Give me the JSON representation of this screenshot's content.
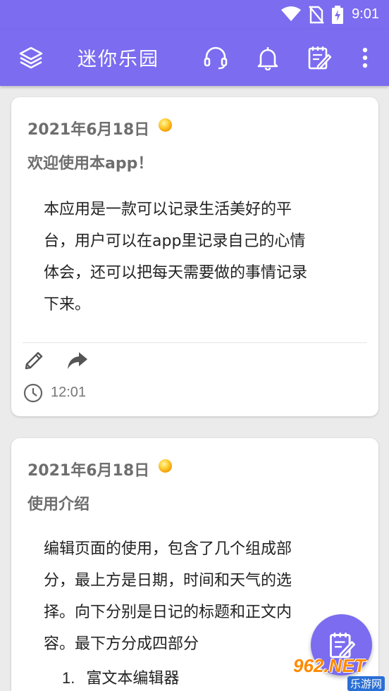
{
  "status_bar": {
    "time": "9:01",
    "icons": [
      "wifi-icon",
      "no-sim-icon",
      "battery-charging-icon"
    ]
  },
  "app_bar": {
    "title": "迷你乐园",
    "icons": [
      "layers-icon",
      "headset-icon",
      "bell-icon",
      "edit-note-icon",
      "more-vert-icon"
    ]
  },
  "entries": [
    {
      "date": "2021年6月18日",
      "weather_icon": "sun-icon",
      "title": "欢迎使用本app！",
      "body_lines": [
        "本应用是一款可以记录生活美好的平",
        "台，用户可以在app里记录自己的心情",
        "体会，还可以把每天需要做的事情记录",
        "下来。"
      ],
      "actions": [
        "pencil-icon",
        "share-icon"
      ],
      "time": "12:01"
    },
    {
      "date": "2021年6月18日",
      "weather_icon": "sun-icon",
      "title": "使用介绍",
      "body_lines": [
        "编辑页面的使用，包含了几个组成部",
        "分，最上方是日期，时间和天气的选",
        "择。向下分别是日记的标题和正文内",
        "容。最下方分成四部分"
      ],
      "list": [
        {
          "num": "1.",
          "text": "富文本编辑器"
        }
      ]
    }
  ],
  "fab": {
    "icon": "edit-note-icon"
  },
  "watermark": {
    "main": "962.NET",
    "sub": "乐游网"
  },
  "colors": {
    "primary": "#7b6cf0",
    "background": "#ebebeb",
    "card": "#ffffff",
    "weather": "#f5a500"
  }
}
